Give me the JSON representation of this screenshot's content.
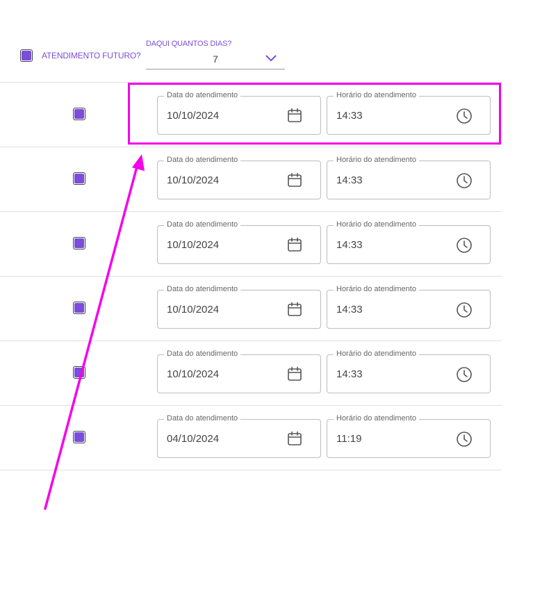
{
  "header": {
    "future_label": "ATENDIMENTO FUTURO?",
    "days_label": "DAQUI QUANTOS DIAS?",
    "days_value": "7"
  },
  "rows": [
    {
      "date_label": "Data do atendimento",
      "date": "10/10/2024",
      "time_label": "Horário do atendimento",
      "time": "14:33",
      "checked": true
    },
    {
      "date_label": "Data do atendimento",
      "date": "10/10/2024",
      "time_label": "Horário do atendimento",
      "time": "14:33",
      "checked": true
    },
    {
      "date_label": "Data do atendimento",
      "date": "10/10/2024",
      "time_label": "Horário do atendimento",
      "time": "14:33",
      "checked": true
    },
    {
      "date_label": "Data do atendimento",
      "date": "10/10/2024",
      "time_label": "Horário do atendimento",
      "time": "14:33",
      "checked": true
    },
    {
      "date_label": "Data do atendimento",
      "date": "10/10/2024",
      "time_label": "Horário do atendimento",
      "time": "14:33",
      "checked": true
    },
    {
      "date_label": "Data do atendimento",
      "date": "04/10/2024",
      "time_label": "Horário do atendimento",
      "time": "11:19",
      "checked": true
    }
  ],
  "icons": {
    "date": "calendar-icon",
    "time": "clock-icon",
    "dropdown": "chevron-down-icon"
  },
  "colors": {
    "accent": "#7c4ddb",
    "annotation": "#f400ea"
  }
}
